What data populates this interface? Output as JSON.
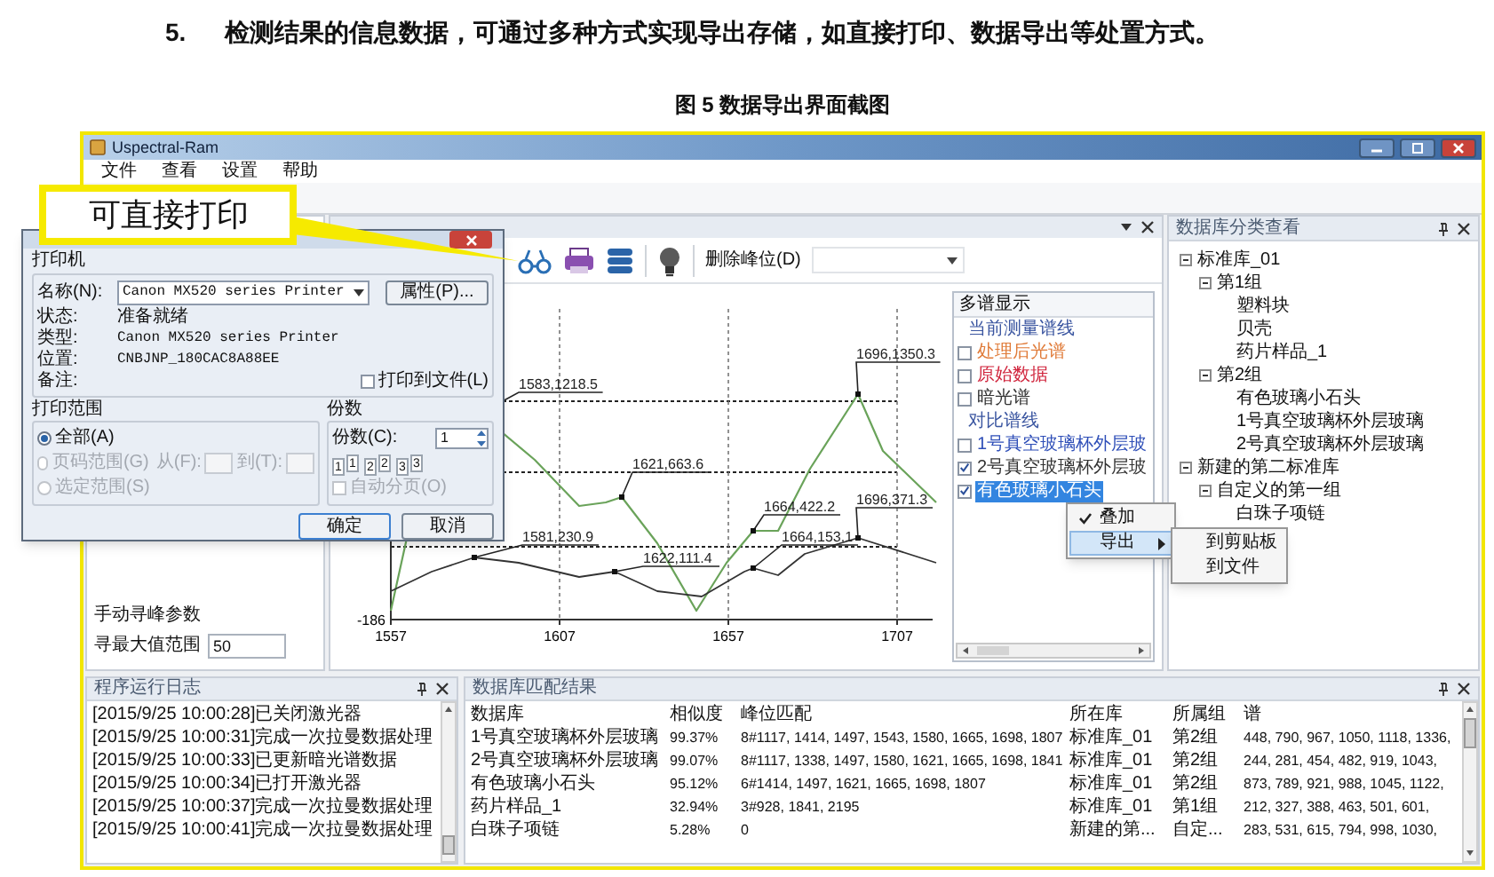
{
  "heading": {
    "number": "5.",
    "text": "检测结果的信息数据，可通过多种方式实现导出存储，如直接打印、数据导出等处置方式。"
  },
  "caption": "图 5 数据导出界面截图",
  "callout": "可直接打印",
  "window": {
    "title": "Uspectral-Ram"
  },
  "menu": [
    "文件",
    "查看",
    "设置",
    "帮助"
  ],
  "peak_params": {
    "title": "手动寻峰参数",
    "label": "寻最大值范围",
    "value": "50"
  },
  "chart_toolbar": {
    "dropdown_label": "删除峰位(D)"
  },
  "chart": {
    "x_tick_labels": [
      "1557",
      "1607",
      "1657",
      "1707"
    ],
    "y_tick_label": "-186",
    "peak_labels": [
      "1583,1218.5",
      "1621,663.6",
      "1581,230.9",
      "1622,111.4",
      "1664,422.2",
      "1664,153.1",
      "1696,1350.3",
      "1696,371.3"
    ]
  },
  "multi": {
    "title": "多谱显示",
    "sections": [
      {
        "title": "当前测量谱线",
        "items": [
          {
            "label": "处理后光谱",
            "checked": false,
            "selected": false,
            "color": "#e07b39"
          },
          {
            "label": "原始数据",
            "checked": false,
            "selected": false,
            "color": "#d0243c"
          },
          {
            "label": "暗光谱",
            "checked": false,
            "selected": false,
            "color": "#333333"
          }
        ]
      },
      {
        "title": "对比谱线",
        "items": [
          {
            "label": "1号真空玻璃杯外层玻",
            "checked": false,
            "selected": false,
            "color": "#2f4fb8"
          },
          {
            "label": "2号真空玻璃杯外层玻",
            "checked": true,
            "selected": false,
            "color": "#333333"
          },
          {
            "label": "有色玻璃小石头",
            "checked": true,
            "selected": true
          }
        ]
      }
    ]
  },
  "context_menu": {
    "items": [
      {
        "label": "叠加",
        "checked": true,
        "selected": false,
        "kind": "item"
      },
      {
        "label": "导出",
        "checked": false,
        "selected": true,
        "kind": "submenu"
      }
    ],
    "submenu": [
      "到剪贴板",
      "到文件"
    ]
  },
  "tree": {
    "title": "数据库分类查看",
    "items": [
      {
        "label": "标准库_01",
        "expanded": true,
        "children": [
          {
            "label": "第1组",
            "expanded": true,
            "children": [
              {
                "label": "塑料块"
              },
              {
                "label": "贝壳"
              },
              {
                "label": "药片样品_1"
              }
            ]
          },
          {
            "label": "第2组",
            "expanded": true,
            "children": [
              {
                "label": "有色玻璃小石头"
              },
              {
                "label": "1号真空玻璃杯外层玻璃"
              },
              {
                "label": "2号真空玻璃杯外层玻璃"
              }
            ]
          }
        ]
      },
      {
        "label": "新建的第二标准库",
        "expanded": true,
        "children": [
          {
            "label": "自定义的第一组",
            "expanded": true,
            "children": [
              {
                "label": "白珠子项链"
              }
            ]
          }
        ]
      }
    ]
  },
  "log": {
    "title": "程序运行日志",
    "lines": [
      "[2015/9/25 10:00:28]已关闭激光器",
      "[2015/9/25 10:00:31]完成一次拉曼数据处理",
      "[2015/9/25 10:00:33]已更新暗光谱数据",
      "[2015/9/25 10:00:34]已打开激光器",
      "[2015/9/25 10:00:37]完成一次拉曼数据处理",
      "[2015/9/25 10:00:41]完成一次拉曼数据处理"
    ]
  },
  "results": {
    "title": "数据库匹配结果",
    "columns": [
      "数据库",
      "相似度",
      "峰位匹配",
      "所在库",
      "所属组",
      "谱"
    ],
    "rows": [
      [
        "1号真空玻璃杯外层玻璃",
        "99.37%",
        "8#1117, 1414, 1497, 1543, 1580, 1665, 1698, 1807",
        "标准库_01",
        "第2组",
        "448, 790, 967, 1050, 1118, 1336,"
      ],
      [
        "2号真空玻璃杯外层玻璃",
        "99.07%",
        "8#1117, 1338, 1497, 1580, 1621, 1665, 1698, 1841",
        "标准库_01",
        "第2组",
        "244, 281, 454, 482, 919, 1043,"
      ],
      [
        "有色玻璃小石头",
        "95.12%",
        "6#1414, 1497, 1621, 1665, 1698, 1807",
        "标准库_01",
        "第2组",
        "873, 789, 921, 988, 1045, 1122,"
      ],
      [
        "药片样品_1",
        "32.94%",
        "3#928, 1841, 2195",
        "标准库_01",
        "第1组",
        "212, 327, 388, 463, 501, 601,"
      ],
      [
        "白珠子项链",
        "5.28%",
        "0",
        "新建的第...",
        "自定...",
        "283, 531, 615, 794, 998, 1030,"
      ]
    ]
  },
  "dialog": {
    "printer_group": "打印机",
    "name_label": "名称(N):",
    "printer_name": "Canon MX520 series Printer",
    "properties_button": "属性(P)...",
    "info": [
      {
        "label": "状态:",
        "value": "准备就绪"
      },
      {
        "label": "类型:",
        "value": "Canon MX520 series Printer"
      },
      {
        "label": "位置:",
        "value": "CNBJNP_180CAC8A88EE"
      },
      {
        "label": "备注:"
      }
    ],
    "print_to_file": {
      "label": "打印到文件(L)",
      "checked": false
    },
    "range_group": "打印范围",
    "ranges": [
      {
        "label": "全部(A)",
        "selected": true,
        "disabled": false
      },
      {
        "label": "页码范围(G)",
        "selected": false,
        "disabled": true
      },
      {
        "label": "选定范围(S)",
        "selected": false,
        "disabled": true
      }
    ],
    "from_label": "从(F):",
    "to_label": "到(T):",
    "copies_group": "份数",
    "copies_label": "份数(C):",
    "copies_value": "1",
    "collate_digits": [
      "1",
      "1",
      "2",
      "2",
      "3",
      "3"
    ],
    "collate": {
      "label": "自动分页(O)",
      "checked": false,
      "disabled": true
    },
    "buttons": [
      "确定",
      "取消"
    ]
  }
}
